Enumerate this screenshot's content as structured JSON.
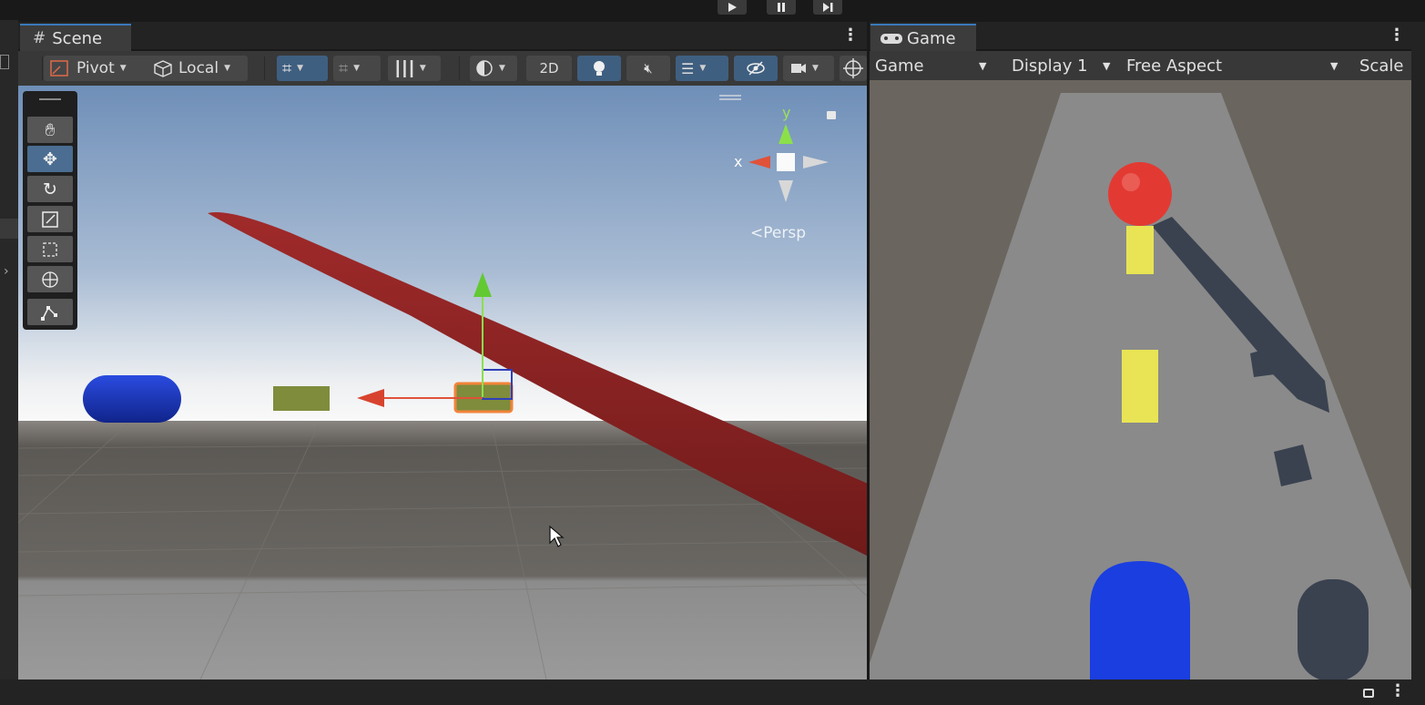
{
  "top_controls": {
    "play_icon": "play-icon",
    "pause_icon": "pause-icon",
    "step_icon": "step-icon"
  },
  "scene": {
    "tab_label": "Scene",
    "toolbar": {
      "pivot_label": "Pivot",
      "local_label": "Local",
      "two_d_label": "2D"
    },
    "tools": [
      "hand-tool",
      "move-tool",
      "rotate-tool",
      "scale-tool",
      "rect-tool",
      "transform-tool",
      "custom-tool"
    ],
    "gizmo": {
      "x_label": "x",
      "y_label": "y",
      "persp_label": "Persp"
    },
    "colors": {
      "sky_top": "#6f8fb8",
      "ground": "#5d5a57",
      "blade": "#8a2222",
      "capsule": "#1a3ab8",
      "cube": "#7e8c3c",
      "selection": "#f2843a"
    }
  },
  "game": {
    "tab_label": "Game",
    "toolbar": {
      "view_select": "Game",
      "display_select": "Display 1",
      "aspect_select": "Free Aspect",
      "scale_label": "Scale"
    },
    "colors": {
      "background": "#6a655e",
      "track": "#8a8a8a",
      "ball": "#e23a33",
      "cube": "#e8e455",
      "capsule": "#1a3ee0",
      "shadow": "#3a4250"
    }
  }
}
